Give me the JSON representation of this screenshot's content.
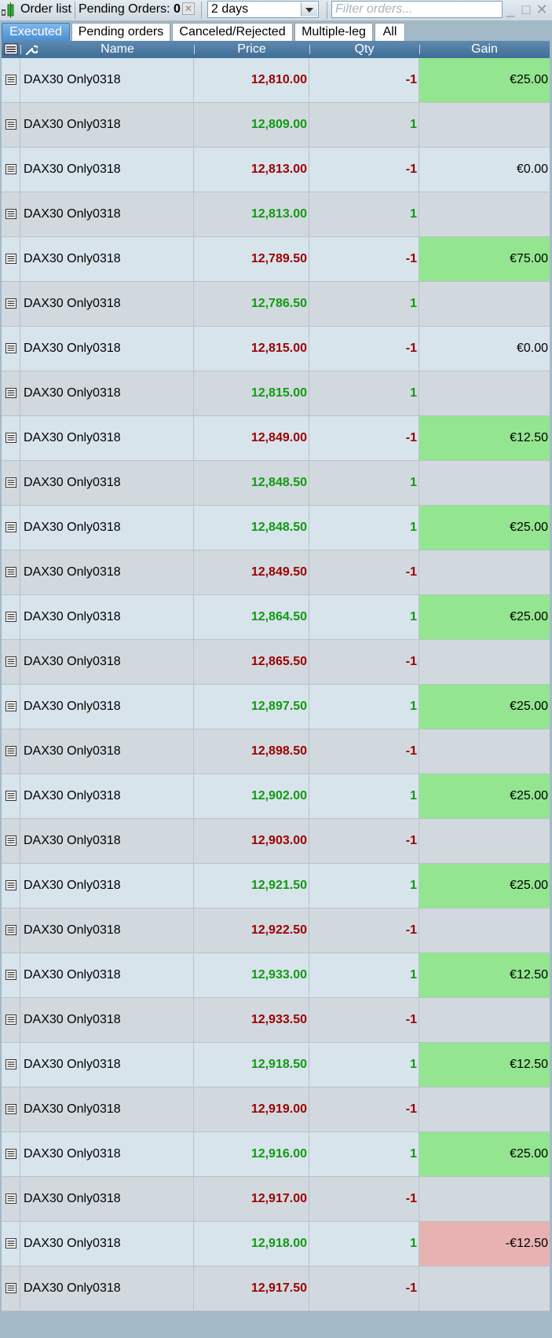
{
  "toolbar": {
    "title": "Order list",
    "pending_label": "Pending Orders:",
    "pending_count": "0",
    "period": "2 days",
    "filter_placeholder": "Filter orders..."
  },
  "tabs": [
    "Executed",
    "Pending orders",
    "Canceled/Rejected",
    "Multiple-leg",
    "All"
  ],
  "active_tab": "Executed",
  "columns": {
    "name": "Name",
    "price": "Price",
    "qty": "Qty",
    "gain": "Gain"
  },
  "colors": {
    "sell": "#9b0000",
    "buy": "#119a11",
    "gain_positive": "#93e68f",
    "gain_negative": "#e8b2b2",
    "accent": "#4b8fd2"
  },
  "rows": [
    {
      "name": "DAX30 Only0318",
      "price": "12,810.00",
      "qty": "-1",
      "gain": "€25.00"
    },
    {
      "name": "DAX30 Only0318",
      "price": "12,809.00",
      "qty": "1",
      "gain": ""
    },
    {
      "name": "DAX30 Only0318",
      "price": "12,813.00",
      "qty": "-1",
      "gain": "€0.00"
    },
    {
      "name": "DAX30 Only0318",
      "price": "12,813.00",
      "qty": "1",
      "gain": ""
    },
    {
      "name": "DAX30 Only0318",
      "price": "12,789.50",
      "qty": "-1",
      "gain": "€75.00"
    },
    {
      "name": "DAX30 Only0318",
      "price": "12,786.50",
      "qty": "1",
      "gain": ""
    },
    {
      "name": "DAX30 Only0318",
      "price": "12,815.00",
      "qty": "-1",
      "gain": "€0.00"
    },
    {
      "name": "DAX30 Only0318",
      "price": "12,815.00",
      "qty": "1",
      "gain": ""
    },
    {
      "name": "DAX30 Only0318",
      "price": "12,849.00",
      "qty": "-1",
      "gain": "€12.50"
    },
    {
      "name": "DAX30 Only0318",
      "price": "12,848.50",
      "qty": "1",
      "gain": ""
    },
    {
      "name": "DAX30 Only0318",
      "price": "12,848.50",
      "qty": "1",
      "gain": "€25.00"
    },
    {
      "name": "DAX30 Only0318",
      "price": "12,849.50",
      "qty": "-1",
      "gain": ""
    },
    {
      "name": "DAX30 Only0318",
      "price": "12,864.50",
      "qty": "1",
      "gain": "€25.00"
    },
    {
      "name": "DAX30 Only0318",
      "price": "12,865.50",
      "qty": "-1",
      "gain": ""
    },
    {
      "name": "DAX30 Only0318",
      "price": "12,897.50",
      "qty": "1",
      "gain": "€25.00"
    },
    {
      "name": "DAX30 Only0318",
      "price": "12,898.50",
      "qty": "-1",
      "gain": ""
    },
    {
      "name": "DAX30 Only0318",
      "price": "12,902.00",
      "qty": "1",
      "gain": "€25.00"
    },
    {
      "name": "DAX30 Only0318",
      "price": "12,903.00",
      "qty": "-1",
      "gain": ""
    },
    {
      "name": "DAX30 Only0318",
      "price": "12,921.50",
      "qty": "1",
      "gain": "€25.00"
    },
    {
      "name": "DAX30 Only0318",
      "price": "12,922.50",
      "qty": "-1",
      "gain": ""
    },
    {
      "name": "DAX30 Only0318",
      "price": "12,933.00",
      "qty": "1",
      "gain": "€12.50"
    },
    {
      "name": "DAX30 Only0318",
      "price": "12,933.50",
      "qty": "-1",
      "gain": ""
    },
    {
      "name": "DAX30 Only0318",
      "price": "12,918.50",
      "qty": "1",
      "gain": "€12.50"
    },
    {
      "name": "DAX30 Only0318",
      "price": "12,919.00",
      "qty": "-1",
      "gain": ""
    },
    {
      "name": "DAX30 Only0318",
      "price": "12,916.00",
      "qty": "1",
      "gain": "€25.00"
    },
    {
      "name": "DAX30 Only0318",
      "price": "12,917.00",
      "qty": "-1",
      "gain": ""
    },
    {
      "name": "DAX30 Only0318",
      "price": "12,918.00",
      "qty": "1",
      "gain": "-€12.50"
    },
    {
      "name": "DAX30 Only0318",
      "price": "12,917.50",
      "qty": "-1",
      "gain": ""
    }
  ]
}
